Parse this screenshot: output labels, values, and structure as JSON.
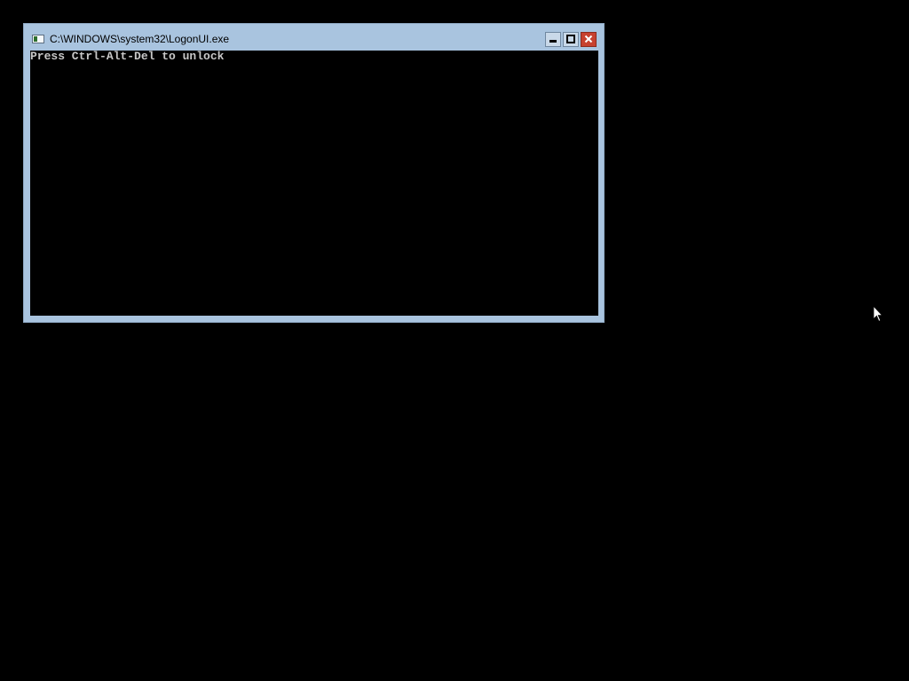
{
  "window": {
    "title": "C:\\WINDOWS\\system32\\LogonUI.exe",
    "icon": "console-window-icon",
    "buttons": {
      "minimize": "minimize-icon",
      "maximize": "maximize-icon",
      "close": "close-icon"
    }
  },
  "console": {
    "lines": [
      "Press Ctrl-Alt-Del to unlock"
    ]
  },
  "colors": {
    "desktop": "#000000",
    "window_frame": "#a9c4df",
    "console_background": "#000000",
    "console_text": "#c8c8c8",
    "close_button": "#c7412f"
  }
}
